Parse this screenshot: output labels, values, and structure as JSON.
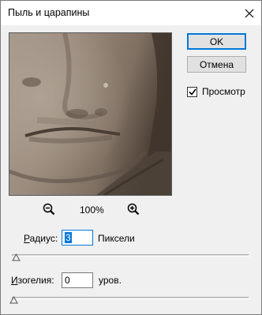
{
  "window": {
    "title": "Пыль и царапины"
  },
  "buttons": {
    "ok_label": "OK",
    "cancel_label": "Отмена"
  },
  "preview_checkbox": {
    "label": "Просмотр",
    "checked": true
  },
  "zoom": {
    "value": "100%",
    "zoom_out_icon": "zoom-out-icon",
    "zoom_in_icon": "zoom-in-icon"
  },
  "radius": {
    "label_underlined": "Р",
    "label_rest": "адиус:",
    "value": "3",
    "unit": "Пиксели",
    "slider_fraction": 0.0
  },
  "threshold": {
    "label_underlined": "И",
    "label_rest": "зогелия:",
    "value": "0",
    "unit": "уров.",
    "slider_fraction": 0.0
  },
  "colors": {
    "accent": "#0078d7",
    "dialog_bg": "#f0f0f0",
    "sepia_photo": "#8f7f70"
  }
}
